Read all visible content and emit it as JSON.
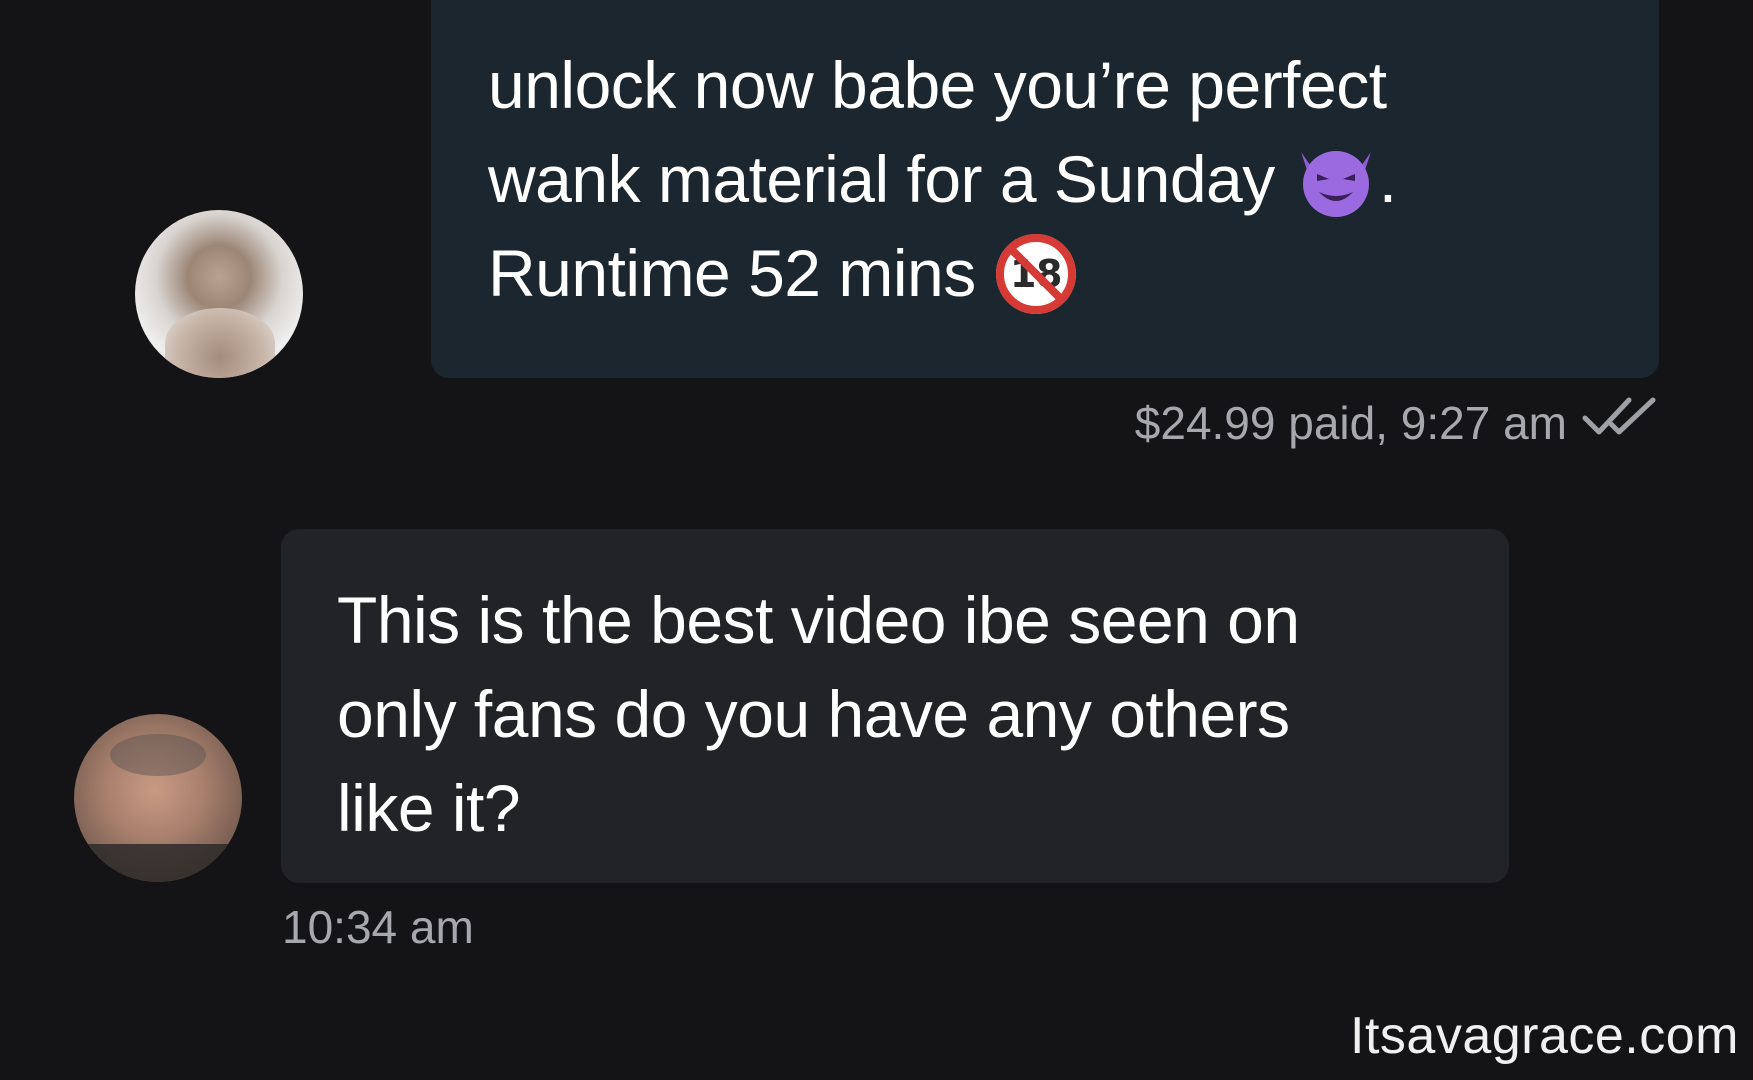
{
  "messages": {
    "outgoing": {
      "lines": [
        "unlock now babe you’re perfect",
        "wank material for a Sunday",
        "Runtime 52 mins"
      ],
      "trailing_dot": ".",
      "emojis": [
        "smiling-devil-emoji",
        "no-under-eighteen-emoji"
      ],
      "meta": "$24.99 paid, 9:27 am"
    },
    "incoming": {
      "lines": [
        "This is the best video ibe seen on",
        "only fans do you have any others",
        "like it?"
      ],
      "meta": "10:34 am"
    }
  },
  "watermark": "Itsavagrace.com",
  "colors": {
    "background": "#141416",
    "outgoing_bubble": "#1b262f",
    "incoming_bubble": "#222326",
    "message_text": "#ffffff",
    "meta_text": "#a6a8ad"
  }
}
